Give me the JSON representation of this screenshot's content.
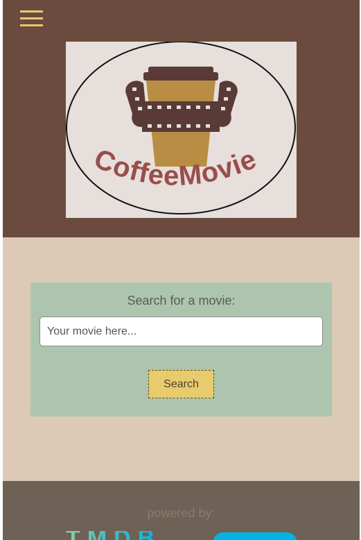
{
  "header": {
    "menu_icon": "hamburger-menu-icon",
    "logo": {
      "text": "CoffeeMovie",
      "icon": "coffee-cup-film-reel-icon"
    }
  },
  "search": {
    "title": "Search for a movie:",
    "input_placeholder": "Your movie here...",
    "input_value": "",
    "button_label": "Search"
  },
  "footer": {
    "powered_by": "powered by:",
    "tmdb_logo_text": "TMDB"
  },
  "colors": {
    "header_bg": "#6b4b3e",
    "accent": "#e8c96f",
    "main_bg": "#dccab6",
    "panel_bg": "#adc5ae",
    "button_bg": "#e8cb6c",
    "footer_bg": "#6e6155",
    "tmdb_green": "#90cea1",
    "tmdb_blue": "#01b4e4"
  }
}
